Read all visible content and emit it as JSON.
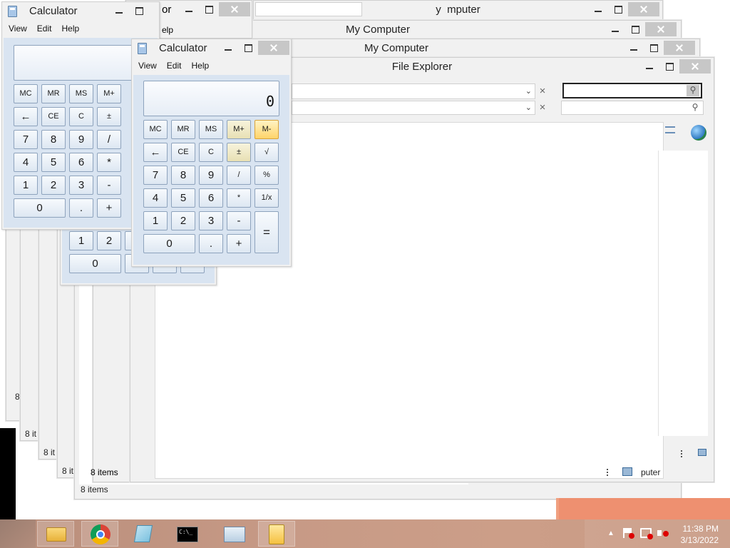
{
  "calculator": {
    "title": "Calculator",
    "menu": [
      "View",
      "Edit",
      "Help"
    ],
    "display_value": "0",
    "memory_buttons": [
      "MC",
      "MR",
      "MS",
      "M+",
      "M-"
    ],
    "row2": [
      "←",
      "CE",
      "C",
      "±",
      "√"
    ],
    "row3": [
      "7",
      "8",
      "9",
      "/",
      "%"
    ],
    "row4": [
      "4",
      "5",
      "6",
      "*",
      "1/x"
    ],
    "row5": [
      "1",
      "2",
      "3",
      "-"
    ],
    "equals": "=",
    "row6": [
      "0",
      ".",
      "+"
    ]
  },
  "windows": {
    "my_computer_title": "My Computer",
    "file_explorer_title": "File Explorer",
    "status_items": "8 items",
    "status_items_short": "8 it",
    "status_fragment": "8",
    "back_title_fragment": "or",
    "back_title_fragment2": "y",
    "back_title_fragment3": "mputer",
    "menu_fragment": "elp",
    "computer_fragment": "puter"
  },
  "taskbar": {
    "time": "11:38 PM",
    "date": "3/13/2022",
    "apps": [
      "file-explorer",
      "chrome",
      "notepad",
      "command-prompt",
      "performance-monitor",
      "calculator"
    ]
  },
  "colors": {
    "calc_highlight": "#ffd46a",
    "taskbar": "#c79a86",
    "orange": "#ee9070"
  }
}
